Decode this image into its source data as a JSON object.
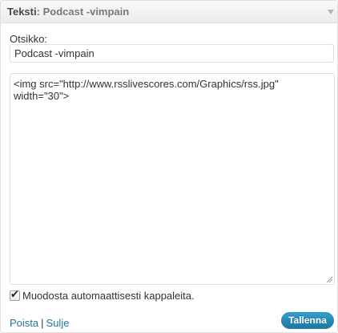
{
  "widget": {
    "title_type": "Teksti",
    "title_sep": ":",
    "title_instance": "Podcast -vimpain",
    "toggle_icon": "triangle-down-icon"
  },
  "form": {
    "title_label": "Otsikko:",
    "title_value": "Podcast -vimpain",
    "content_value": "<img src=\"http://www.rsslivescores.com/Graphics/rss.jpg\" width=\"30\">",
    "autop_label": "Muodosta automaattisesti kappaleita.",
    "autop_checked": true
  },
  "footer": {
    "delete_label": "Poista",
    "separator": "|",
    "close_label": "Sulje",
    "save_label": "Tallenna"
  },
  "colors": {
    "link": "#21759b",
    "button": "#21759b",
    "border": "#dfdfdf"
  }
}
